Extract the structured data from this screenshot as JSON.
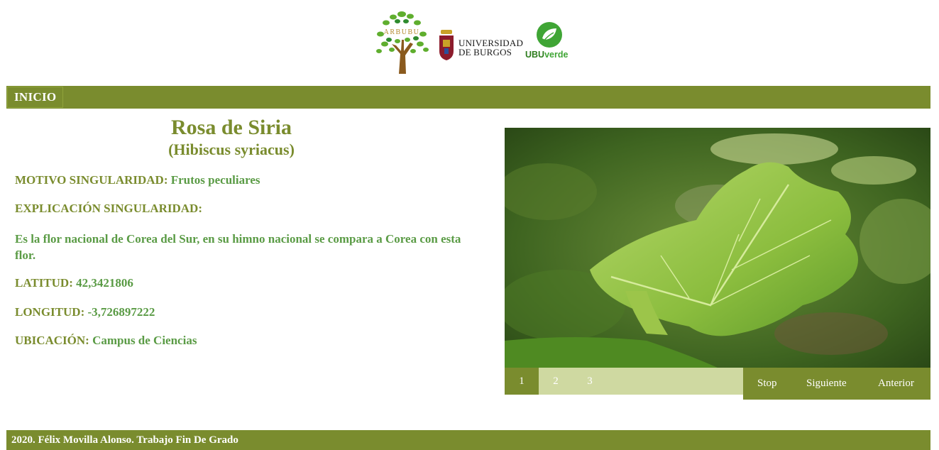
{
  "header": {
    "logos": {
      "arbubu": "ARBUBU",
      "ubu_line1": "UNIVERSIDAD",
      "ubu_line2": "DE BURGOS",
      "ubuverde_prefix": "UBU",
      "ubuverde_suffix": "verde"
    }
  },
  "nav": {
    "inicio_label": "INICIO"
  },
  "tree": {
    "common_name": "Rosa de Siria",
    "scientific_name": "(Hibiscus syriacus)",
    "motivo_label": "MOTIVO SINGULARIDAD:",
    "motivo_value": "Frutos peculiares",
    "explicacion_label": "EXPLICACIÓN SINGULARIDAD:",
    "explicacion_text": "Es la flor nacional de Corea del Sur, en su himno nacional se compara a Corea con esta flor.",
    "latitud_label": "LATITUD:",
    "latitud_value": "42,3421806",
    "longitud_label": "LONGITUD:",
    "longitud_value": "-3,726897222",
    "ubicacion_label": "UBICACIÓN:",
    "ubicacion_value": "Campus de Ciencias"
  },
  "slideshow": {
    "pages": [
      "1",
      "2",
      "3"
    ],
    "active_page": "1",
    "stop_label": "Stop",
    "next_label": "Siguiente",
    "prev_label": "Anterior"
  },
  "footer": {
    "text": "2020. Félix Movilla Alonso. Trabajo Fin De Grado"
  },
  "colors": {
    "olive": "#7a8c2e",
    "value_green": "#5a9b45",
    "pager_light": "#cfd9a1"
  }
}
